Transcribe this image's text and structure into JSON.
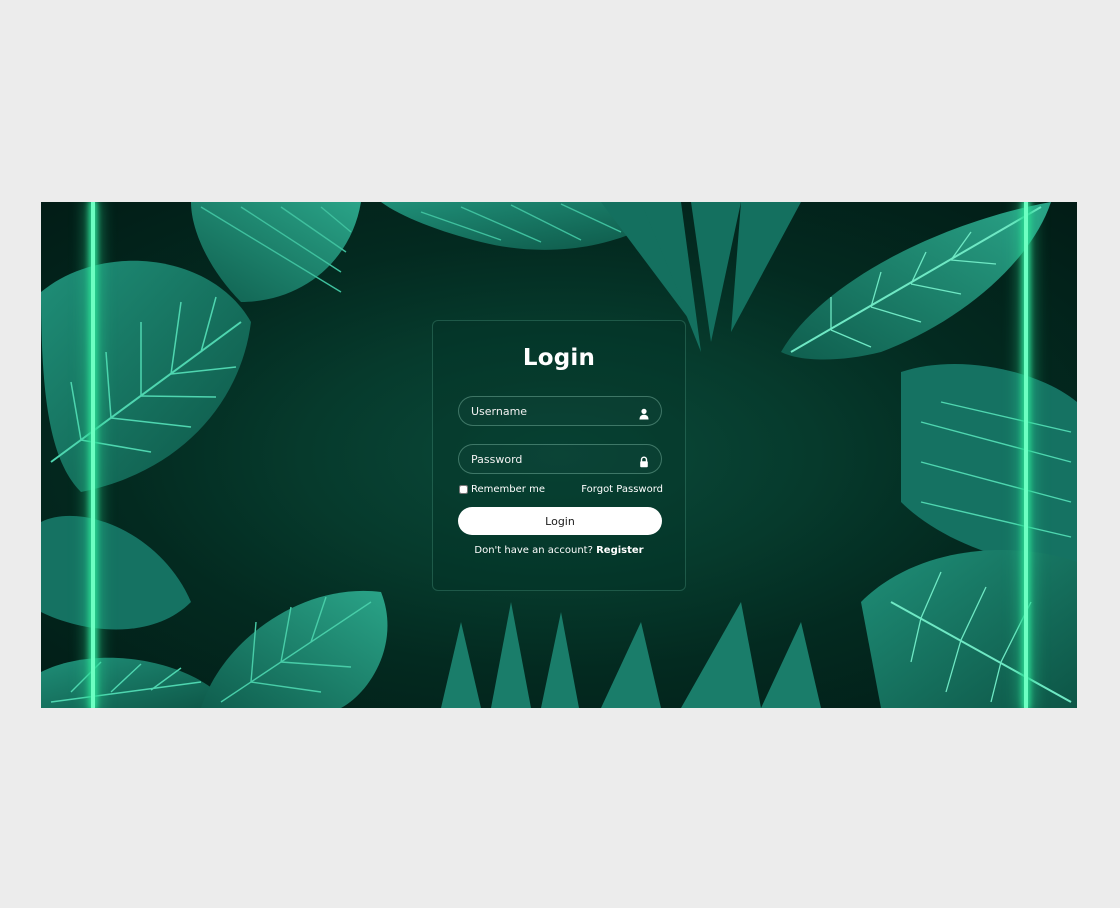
{
  "login": {
    "title": "Login",
    "username_placeholder": "Username",
    "password_placeholder": "Password",
    "remember_label": "Remember me",
    "forgot_label": "Forgot Password",
    "button_label": "Login",
    "no_account_text": "Don't have an account?",
    "register_label": "Register"
  },
  "icons": {
    "username": "user-icon",
    "password": "lock-icon"
  },
  "colors": {
    "page_background": "#ececec",
    "banner_dark": "#021c16",
    "leaf": "#1a7a68",
    "neon": "#6dffc2",
    "button": "#ffffff"
  }
}
